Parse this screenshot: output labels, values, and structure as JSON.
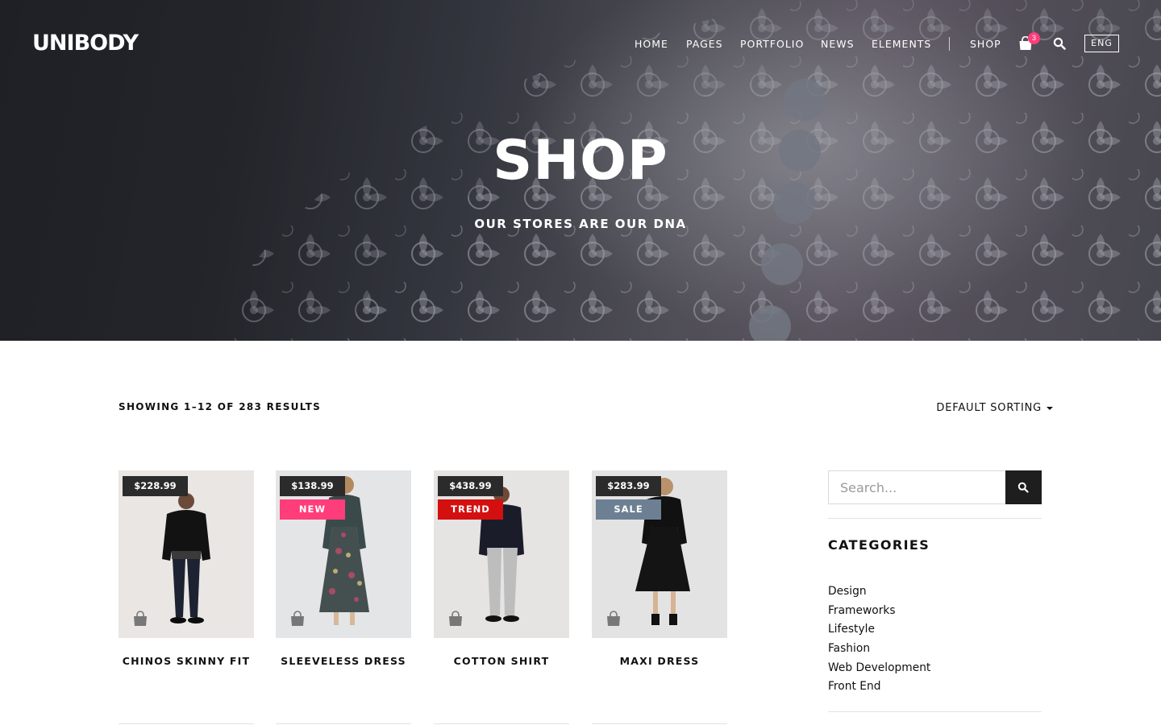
{
  "header": {
    "logo": "UNIBODY",
    "nav": [
      "HOME",
      "PAGES",
      "PORTFOLIO",
      "NEWS",
      "ELEMENTS"
    ],
    "shop_label": "SHOP",
    "cart_count": "3",
    "language": "ENG"
  },
  "hero": {
    "title": "SHOP",
    "subtitle": "OUR STORES ARE OUR DNA"
  },
  "toolbar": {
    "results_text": "SHOWING 1–12 OF 283 RESULTS",
    "sorting_label": "DEFAULT SORTING"
  },
  "products": [
    {
      "name": "CHINOS SKINNY FIT",
      "price": "$228.99",
      "label": ""
    },
    {
      "name": "SLEEVELESS DRESS",
      "price": "$138.99",
      "label": "NEW"
    },
    {
      "name": "COTTON SHIRT",
      "price": "$438.99",
      "label": "TREND"
    },
    {
      "name": "MAXI DRESS",
      "price": "$283.99",
      "label": "SALE"
    }
  ],
  "colors": {
    "new": "#ff3d7a",
    "trend": "#d40f0f",
    "sale": "#6d7f93",
    "price_tag": "#2b2b2b"
  },
  "sidebar": {
    "search_placeholder": "Search...",
    "categories_title": "CATEGORIES",
    "categories": [
      "Design",
      "Frameworks",
      "Lifestyle",
      "Fashion",
      "Web Development",
      "Front End"
    ]
  }
}
